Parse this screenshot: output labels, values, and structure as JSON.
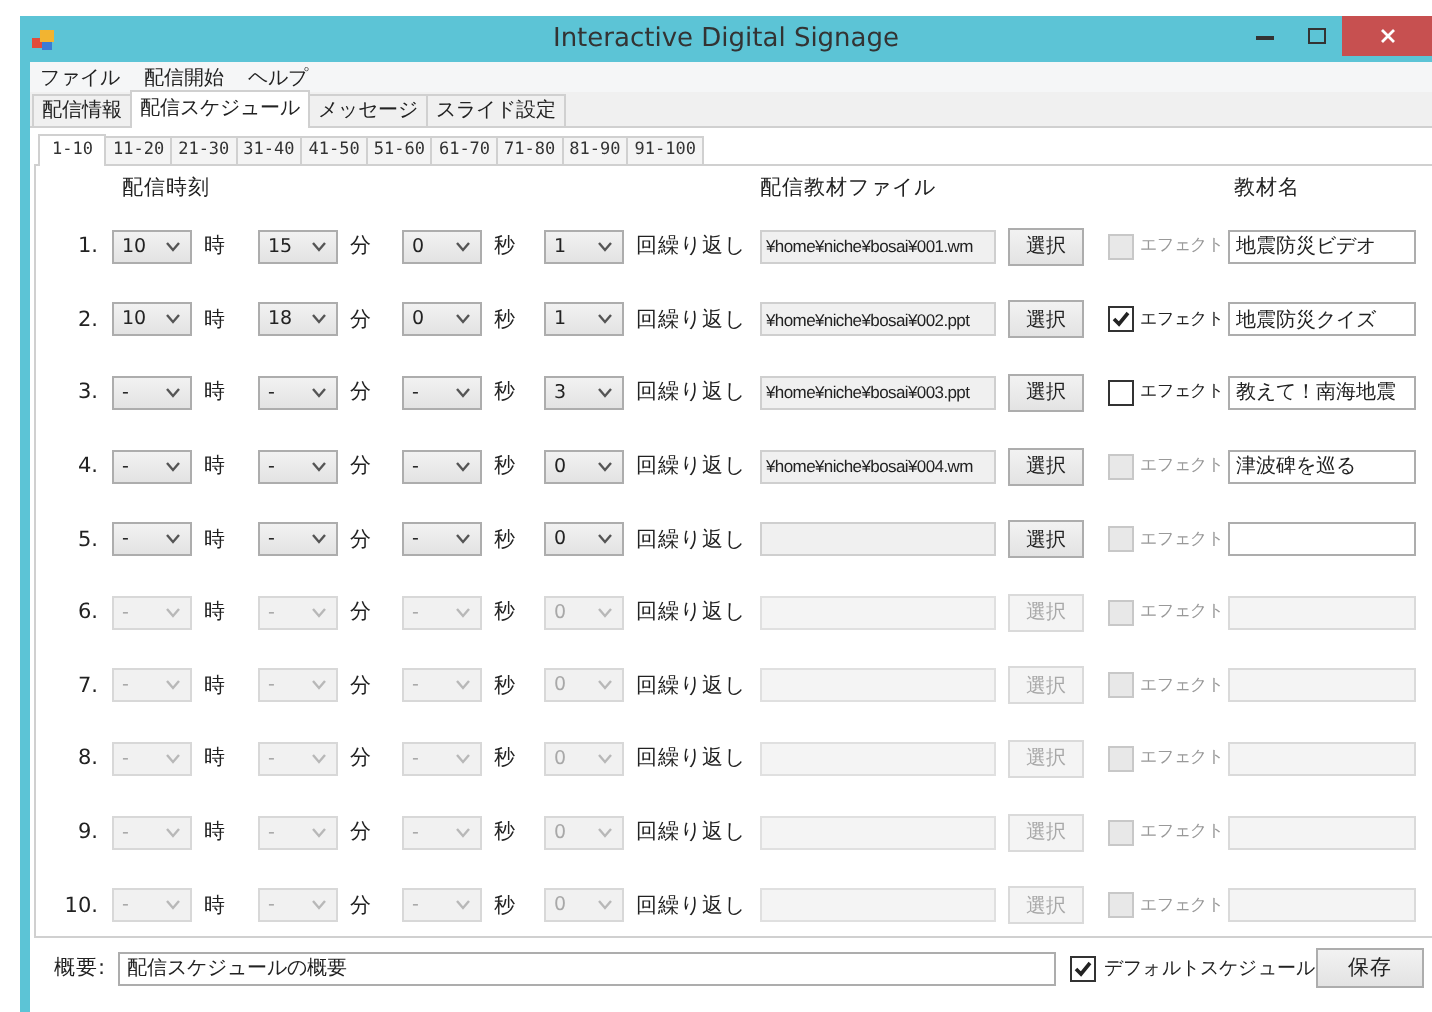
{
  "window": {
    "title": "Interactive Digital Signage"
  },
  "menu": [
    {
      "label": "ファイル"
    },
    {
      "label": "配信開始"
    },
    {
      "label": "ヘルプ"
    }
  ],
  "tabs": [
    {
      "label": "配信情報",
      "selected": false
    },
    {
      "label": "配信スケジュール",
      "selected": true
    },
    {
      "label": "メッセージ",
      "selected": false
    },
    {
      "label": "スライド設定",
      "selected": false
    }
  ],
  "subtabs": [
    {
      "label": "1-10",
      "selected": true
    },
    {
      "label": "11-20",
      "selected": false
    },
    {
      "label": "21-30",
      "selected": false
    },
    {
      "label": "31-40",
      "selected": false
    },
    {
      "label": "41-50",
      "selected": false
    },
    {
      "label": "51-60",
      "selected": false
    },
    {
      "label": "61-70",
      "selected": false
    },
    {
      "label": "71-80",
      "selected": false
    },
    {
      "label": "81-90",
      "selected": false
    },
    {
      "label": "91-100",
      "selected": false
    }
  ],
  "headers": {
    "time": "配信時刻",
    "file": "配信教材ファイル",
    "name": "教材名"
  },
  "rows": [
    {
      "number": "1.",
      "disabled": false,
      "time": [
        {
          "value": "10",
          "unit": "時"
        },
        {
          "value": "15",
          "unit": "分"
        },
        {
          "value": "0",
          "unit": "秒"
        },
        {
          "value": "1",
          "unit": "回繰り返し"
        }
      ],
      "file": "¥home¥niche¥bosai¥001.wm",
      "button": "選択",
      "effect": {
        "label": "エフェクト",
        "checked": false,
        "disabled": true
      },
      "name": "地震防災ビデオ"
    },
    {
      "number": "2.",
      "disabled": false,
      "time": [
        {
          "value": "10",
          "unit": "時"
        },
        {
          "value": "18",
          "unit": "分"
        },
        {
          "value": "0",
          "unit": "秒"
        },
        {
          "value": "1",
          "unit": "回繰り返し"
        }
      ],
      "file": "¥home¥niche¥bosai¥002.ppt",
      "button": "選択",
      "effect": {
        "label": "エフェクト",
        "checked": true,
        "disabled": false
      },
      "name": "地震防災クイズ"
    },
    {
      "number": "3.",
      "disabled": false,
      "time": [
        {
          "value": "-",
          "unit": "時"
        },
        {
          "value": "-",
          "unit": "分"
        },
        {
          "value": "-",
          "unit": "秒"
        },
        {
          "value": "3",
          "unit": "回繰り返し"
        }
      ],
      "file": "¥home¥niche¥bosai¥003.ppt",
      "button": "選択",
      "effect": {
        "label": "エフェクト",
        "checked": false,
        "disabled": false
      },
      "name": "教えて！南海地震"
    },
    {
      "number": "4.",
      "disabled": false,
      "time": [
        {
          "value": "-",
          "unit": "時"
        },
        {
          "value": "-",
          "unit": "分"
        },
        {
          "value": "-",
          "unit": "秒"
        },
        {
          "value": "0",
          "unit": "回繰り返し"
        }
      ],
      "file": "¥home¥niche¥bosai¥004.wm",
      "button": "選択",
      "effect": {
        "label": "エフェクト",
        "checked": false,
        "disabled": true
      },
      "name": "津波碑を巡る"
    },
    {
      "number": "5.",
      "disabled": false,
      "time": [
        {
          "value": "-",
          "unit": "時"
        },
        {
          "value": "-",
          "unit": "分"
        },
        {
          "value": "-",
          "unit": "秒"
        },
        {
          "value": "0",
          "unit": "回繰り返し"
        }
      ],
      "button": "選択",
      "effect": {
        "label": "エフェクト",
        "checked": false,
        "disabled": true
      }
    },
    {
      "number": "6.",
      "disabled": true,
      "time": [
        {
          "value": "-",
          "unit": "時"
        },
        {
          "value": "-",
          "unit": "分"
        },
        {
          "value": "-",
          "unit": "秒"
        },
        {
          "value": "0",
          "unit": "回繰り返し"
        }
      ],
      "button": "選択",
      "effect": {
        "label": "エフェクト",
        "checked": false,
        "disabled": true
      }
    },
    {
      "number": "7.",
      "disabled": true,
      "time": [
        {
          "value": "-",
          "unit": "時"
        },
        {
          "value": "-",
          "unit": "分"
        },
        {
          "value": "-",
          "unit": "秒"
        },
        {
          "value": "0",
          "unit": "回繰り返し"
        }
      ],
      "button": "選択",
      "effect": {
        "label": "エフェクト",
        "checked": false,
        "disabled": true
      }
    },
    {
      "number": "8.",
      "disabled": true,
      "time": [
        {
          "value": "-",
          "unit": "時"
        },
        {
          "value": "-",
          "unit": "分"
        },
        {
          "value": "-",
          "unit": "秒"
        },
        {
          "value": "0",
          "unit": "回繰り返し"
        }
      ],
      "button": "選択",
      "effect": {
        "label": "エフェクト",
        "checked": false,
        "disabled": true
      }
    },
    {
      "number": "9.",
      "disabled": true,
      "time": [
        {
          "value": "-",
          "unit": "時"
        },
        {
          "value": "-",
          "unit": "分"
        },
        {
          "value": "-",
          "unit": "秒"
        },
        {
          "value": "0",
          "unit": "回繰り返し"
        }
      ],
      "button": "選択",
      "effect": {
        "label": "エフェクト",
        "checked": false,
        "disabled": true
      }
    },
    {
      "number": "10.",
      "disabled": true,
      "time": [
        {
          "value": "-",
          "unit": "時"
        },
        {
          "value": "-",
          "unit": "分"
        },
        {
          "value": "-",
          "unit": "秒"
        },
        {
          "value": "0",
          "unit": "回繰り返し"
        }
      ],
      "button": "選択",
      "effect": {
        "label": "エフェクト",
        "checked": false,
        "disabled": true
      }
    }
  ],
  "footer": {
    "summary_label": "概要:",
    "summary": "配信スケジュールの概要",
    "default": {
      "label": "デフォルトスケジュール",
      "checked": true
    },
    "save_button": "保存"
  }
}
